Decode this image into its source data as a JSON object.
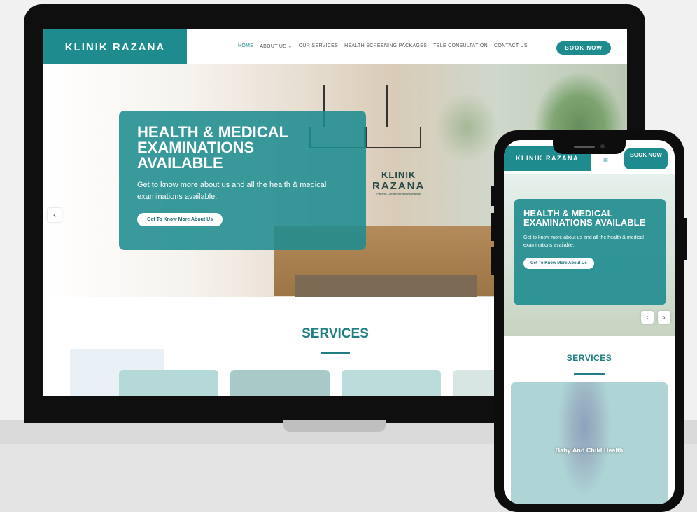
{
  "desktop": {
    "brand": "KLINIK RAZANA",
    "nav": [
      "HOME",
      "ABOUT US",
      "OUR SERVICES",
      "HEALTH SCREENING PACKAGES",
      "TELE CONSULTATION",
      "CONTACT US"
    ],
    "about_caret": "⌄",
    "book_button": "BOOK NOW",
    "hero": {
      "title": "HEALTH & MEDICAL EXAMINATIONS AVAILABLE",
      "text": "Get to know more about us and all the health & medical examinations available.",
      "cta": "Get To Know More About Us",
      "wall_logo_line1": "KLINIK",
      "wall_logo_line2": "RAZANA",
      "wall_logo_line3": "Patient - Centered Family Medicine"
    },
    "arrow_left": "‹",
    "services_title": "SERVICES"
  },
  "mobile": {
    "brand": "KLINIK RAZANA",
    "menu_icon": "≡",
    "book_button": "BOOK NOW",
    "hero": {
      "title": "HEALTH & MEDICAL EXAMINATIONS AVAILABLE",
      "text": "Get to know more about us and all the health & medical examinations available.",
      "cta": "Get To Know More About Us"
    },
    "arrow_prev": "‹",
    "arrow_next": "›",
    "services_title": "SERVICES",
    "service_card_label": "Baby And Child Health"
  },
  "colors": {
    "accent": "#1e8c8f",
    "background": "#f1f1f1"
  }
}
